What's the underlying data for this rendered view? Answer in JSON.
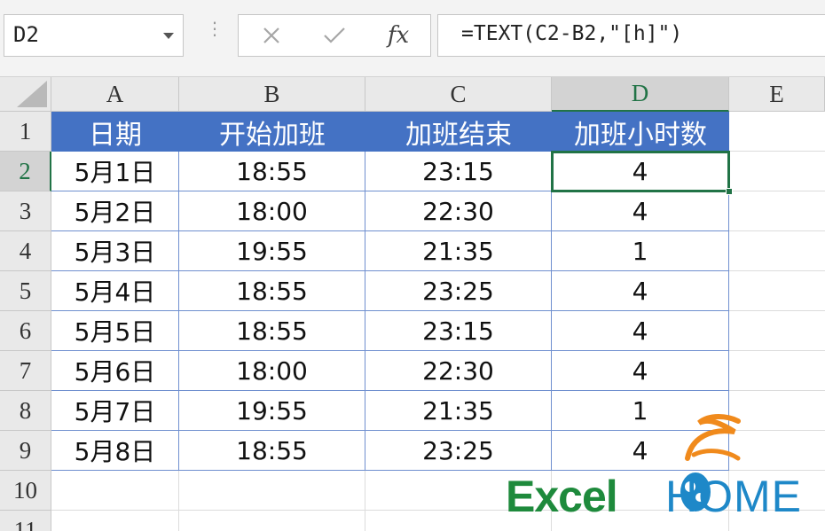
{
  "formula_bar": {
    "name_box": "D2",
    "cancel_icon": "cancel-x-icon",
    "enter_icon": "check-icon",
    "fx_label": "fx",
    "formula": "=TEXT(C2-B2,\"[h]\")"
  },
  "columns": [
    "A",
    "B",
    "C",
    "D",
    "E"
  ],
  "rows": [
    "1",
    "2",
    "3",
    "4",
    "5",
    "6",
    "7",
    "8",
    "9",
    "10",
    "11"
  ],
  "table": {
    "headers": [
      "日期",
      "开始加班",
      "加班结束",
      "加班小时数"
    ],
    "rows": [
      [
        "5月1日",
        "18:55",
        "23:15",
        "4"
      ],
      [
        "5月2日",
        "18:00",
        "22:30",
        "4"
      ],
      [
        "5月3日",
        "19:55",
        "21:35",
        "1"
      ],
      [
        "5月4日",
        "18:55",
        "23:25",
        "4"
      ],
      [
        "5月5日",
        "18:55",
        "23:15",
        "4"
      ],
      [
        "5月6日",
        "18:00",
        "22:30",
        "4"
      ],
      [
        "5月7日",
        "19:55",
        "21:35",
        "1"
      ],
      [
        "5月8日",
        "18:55",
        "23:25",
        "4"
      ]
    ]
  },
  "active_cell": "D2",
  "logo": {
    "part1": "Excel",
    "part2": "HOME"
  },
  "colors": {
    "header_fill": "#4472c4",
    "accent": "#217346",
    "logo_green": "#1e8a3c",
    "logo_blue": "#1e88c8",
    "logo_orange": "#f08a1c"
  }
}
